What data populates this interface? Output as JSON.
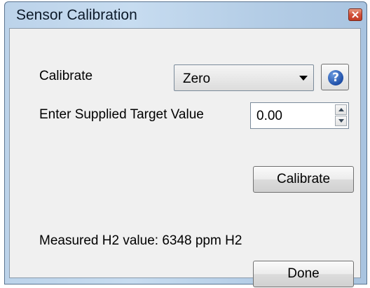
{
  "window": {
    "title": "Sensor Calibration"
  },
  "form": {
    "calibrate_label": "Calibrate",
    "calibrate_mode": "Zero",
    "target_label": "Enter Supplied Target Value",
    "target_value": "0.00",
    "calibrate_button": "Calibrate",
    "measured_text": "Measured H2 value: 6348 ppm H2",
    "done_button": "Done"
  },
  "icons": {
    "close": "close-icon",
    "dropdown": "chevron-down-icon",
    "help": "help-icon",
    "spin_up": "arrow-up-icon",
    "spin_down": "arrow-down-icon"
  },
  "colors": {
    "titlebar": "#bcd3ea",
    "client": "#f0f0f0",
    "close": "#c23a22",
    "help": "#1f4fa8"
  }
}
